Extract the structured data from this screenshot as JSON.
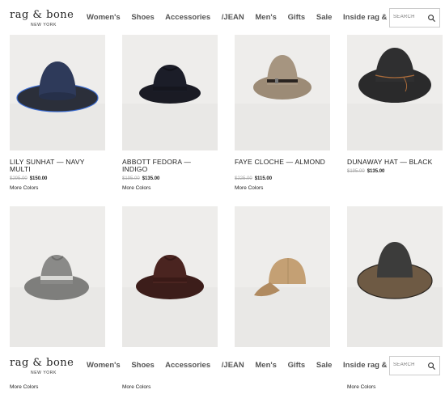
{
  "brand": {
    "name": "rag & bone",
    "sub": "NEW YORK"
  },
  "nav": [
    "Women's",
    "Shoes",
    "Accessories",
    "/JEAN",
    "Men's",
    "Gifts",
    "Sale",
    "Inside rag & bone"
  ],
  "search": {
    "placeholder": "SEARCH"
  },
  "products_row1": [
    {
      "name": "LILY SUNHAT — NAVY MULTI",
      "old_price": "$295.00",
      "price": "$150.00",
      "more": "More Colors",
      "hat_color": "#2e3a5a",
      "band_color": "#2b3550"
    },
    {
      "name": "ABBOTT FEDORA — INDIGO",
      "old_price": "$195.00",
      "price": "$135.00",
      "more": "More Colors",
      "hat_color": "#1b1d28",
      "band_color": "#15161e"
    },
    {
      "name": "FAYE CLOCHE — ALMOND",
      "old_price": "$225.00",
      "price": "$115.00",
      "more": "More Colors",
      "hat_color": "#a69580",
      "band_color": "#2a2420"
    },
    {
      "name": "DUNAWAY HAT — BLACK",
      "old_price": "$195.00",
      "price": "$135.00",
      "more": "",
      "hat_color": "#2f2f30",
      "band_color": "#a86a3a"
    }
  ],
  "products_row2": [
    {
      "more": "More Colors",
      "hat_color": "#8a8a88",
      "band_color": "#d9d9d6"
    },
    {
      "more": "More Colors",
      "hat_color": "#4a2420",
      "band_color": "#3a1a17"
    },
    {
      "more": "",
      "hat_color": "#c4a074",
      "band_color": "#b08a60"
    },
    {
      "more": "More Colors",
      "hat_color": "#3c3c3b",
      "band_color": "#6e5a44"
    }
  ],
  "colors": {
    "nav_text": "#555555",
    "strike": "#aaaaaa"
  }
}
